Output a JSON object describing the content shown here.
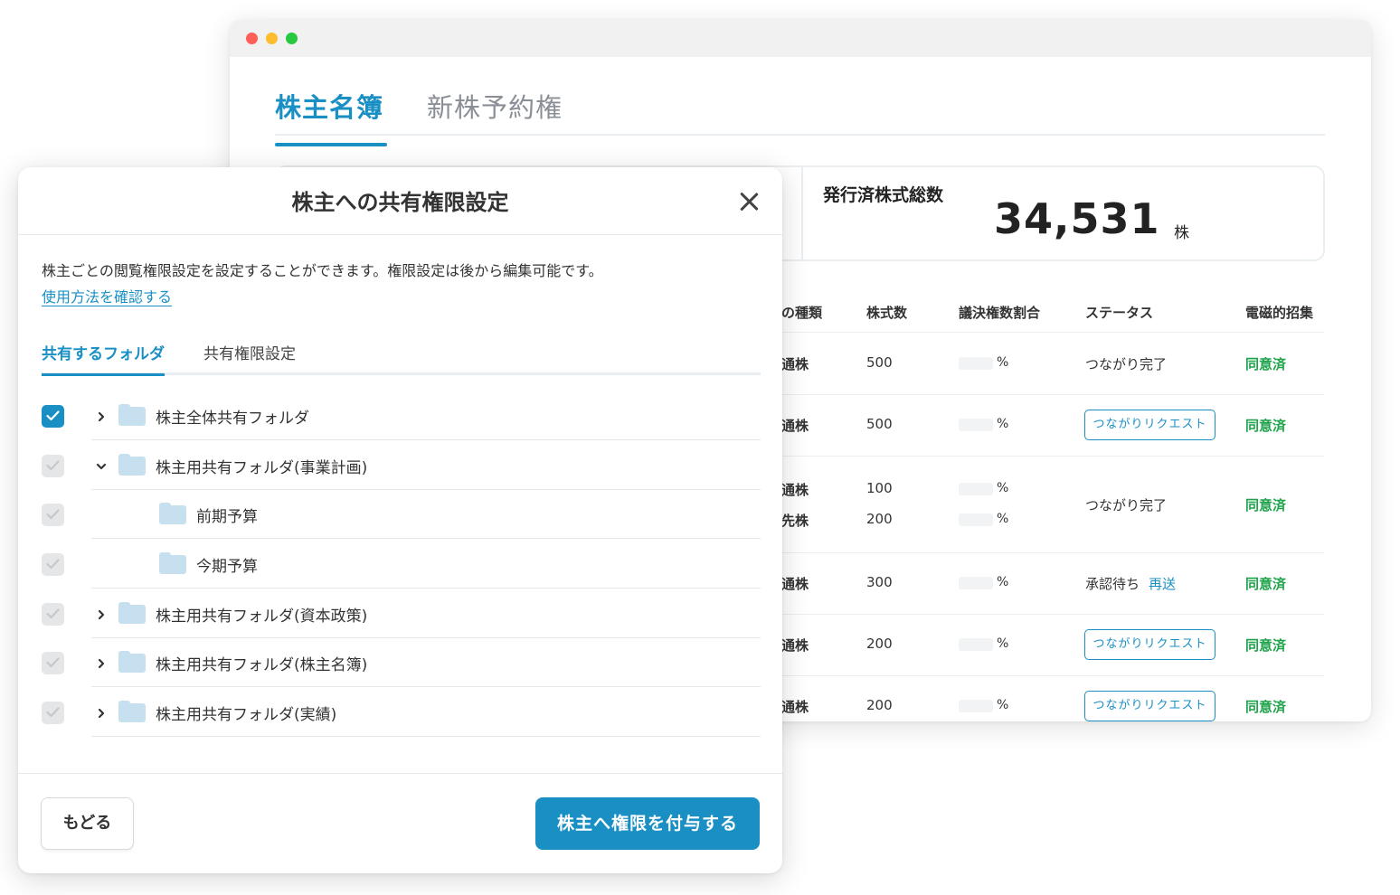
{
  "window": {
    "tabs": [
      {
        "label": "株主名簿",
        "active": true
      },
      {
        "label": "新株予約権",
        "active": false
      }
    ],
    "summary": {
      "label": "発行済株式総数",
      "value": "34,531",
      "unit": "株"
    },
    "table": {
      "headers": [
        "の種類",
        "株式数",
        "議決権数割合",
        "ステータス",
        "電磁的招集"
      ],
      "rows": [
        {
          "types": [
            "通株"
          ],
          "shares": [
            "500"
          ],
          "pct": [
            "%"
          ],
          "status": "つながり完了",
          "status_kind": "text",
          "consent": "同意済"
        },
        {
          "types": [
            "通株"
          ],
          "shares": [
            "500"
          ],
          "pct": [
            "%"
          ],
          "status": "つながりリクエスト",
          "status_kind": "button",
          "consent": "同意済"
        },
        {
          "types": [
            "通株",
            "先株"
          ],
          "shares": [
            "100",
            "200"
          ],
          "pct": [
            "%",
            "%"
          ],
          "status": "つながり完了",
          "status_kind": "text",
          "consent": "同意済"
        },
        {
          "types": [
            "通株"
          ],
          "shares": [
            "300"
          ],
          "pct": [
            "%"
          ],
          "status": "承認待ち",
          "status_kind": "pending",
          "resend": "再送",
          "consent": "同意済"
        },
        {
          "types": [
            "通株"
          ],
          "shares": [
            "200"
          ],
          "pct": [
            "%"
          ],
          "status": "つながりリクエスト",
          "status_kind": "button",
          "consent": "同意済"
        },
        {
          "types": [
            "通株"
          ],
          "shares": [
            "200"
          ],
          "pct": [
            "%"
          ],
          "status": "つながりリクエスト",
          "status_kind": "button",
          "consent": "同意済"
        }
      ]
    }
  },
  "modal": {
    "title": "株主への共有権限設定",
    "description": "株主ごとの閲覧権限設定を設定することができます。権限設定は後から編集可能です。",
    "help_link": "使用方法を確認する",
    "tabs": [
      {
        "label": "共有するフォルダ",
        "active": true
      },
      {
        "label": "共有権限設定",
        "active": false
      }
    ],
    "folders": [
      {
        "label": "株主全体共有フォルダ",
        "checked": true,
        "expander": "collapsed",
        "level": 0
      },
      {
        "label": "株主用共有フォルダ(事業計画)",
        "checked": false,
        "expander": "expanded",
        "level": 0
      },
      {
        "label": "前期予算",
        "checked": false,
        "expander": "none",
        "level": 1
      },
      {
        "label": "今期予算",
        "checked": false,
        "expander": "none",
        "level": 1
      },
      {
        "label": "株主用共有フォルダ(資本政策)",
        "checked": false,
        "expander": "collapsed",
        "level": 0
      },
      {
        "label": "株主用共有フォルダ(株主名簿)",
        "checked": false,
        "expander": "collapsed",
        "level": 0
      },
      {
        "label": "株主用共有フォルダ(実績)",
        "checked": false,
        "expander": "collapsed",
        "level": 0
      }
    ],
    "back_label": "もどる",
    "grant_label": "株主へ権限を付与する"
  },
  "colors": {
    "accent": "#1a8fc4",
    "agree": "#1ea34a",
    "folder": "#c6e0ef",
    "checkbox_off": "#e4e6e8"
  }
}
